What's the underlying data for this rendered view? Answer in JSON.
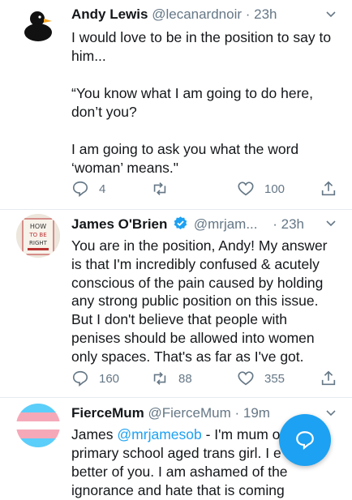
{
  "tweets": [
    {
      "name": "Andy Lewis",
      "handle": "@lecanardnoir",
      "time": "· 23h",
      "body": "I would love to be in the position to say to him...\n\n“You know what I am going to do here, don’t you?\n\nI am going to ask you what the word ‘woman’ means.\"",
      "replies": "4",
      "retweets": "",
      "likes": "100",
      "avatar_icon": "rubber-duck-icon"
    },
    {
      "name": "James O'Brien",
      "handle": "@mrjam...",
      "time": "· 23h",
      "verified": true,
      "body": "You are in the position, Andy! My answer is that I'm incredibly confused & acutely conscious of the pain caused by holding any strong public position on this issue. But I don't believe that people with penises should be allowed into women only spaces. That's as far as I've got.",
      "replies": "160",
      "retweets": "88",
      "likes": "355",
      "avatar_icon": "how-to-be-right-book-icon"
    },
    {
      "name": "FierceMum",
      "handle": "@FierceMum",
      "time": "· 19m",
      "body_prefix": "James ",
      "body_mention": "@mrjamesob",
      "body_rest": " - I'm mum o\nprimary school aged trans girl. I e   d\nbetter of you. I am ashamed of the\nignorance and hate that is coming",
      "avatar_icon": "trans-flag-icon"
    }
  ],
  "colors": {
    "accent": "#1da1f2",
    "muted": "#657786",
    "text": "#14171a"
  },
  "compose_icon": "chat-bubble-icon"
}
